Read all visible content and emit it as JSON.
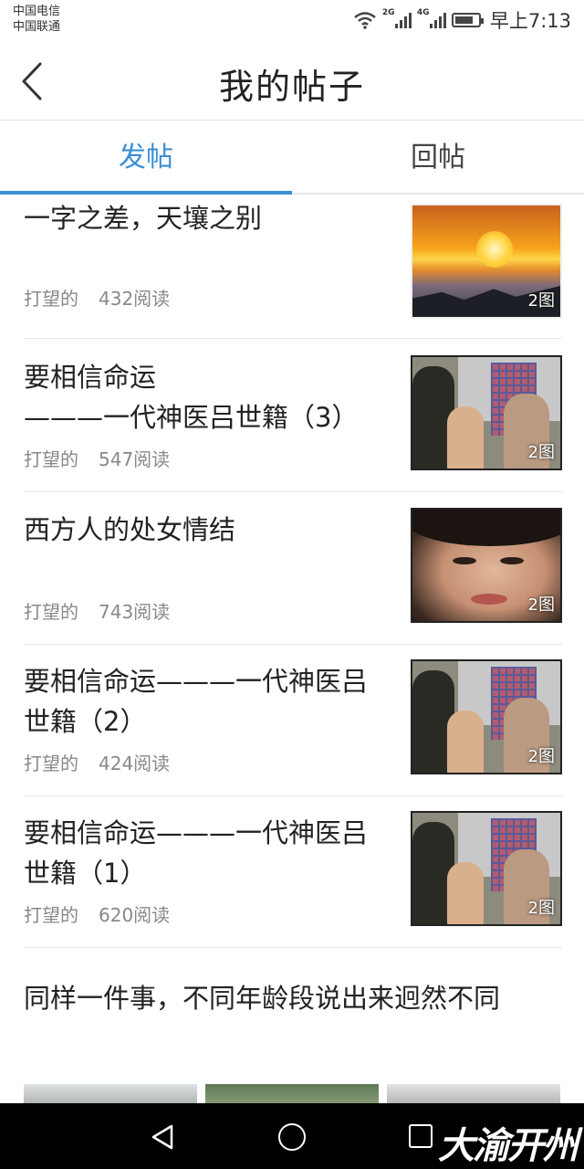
{
  "status_bar": {
    "carrier1": "中国电信",
    "carrier2": "中国联通",
    "net1": "2G",
    "net2": "4G",
    "time": "早上7:13"
  },
  "header": {
    "title": "我的帖子"
  },
  "tabs": [
    {
      "label": "发帖",
      "active": true
    },
    {
      "label": "回帖",
      "active": false
    }
  ],
  "posts": [
    {
      "title": "一字之差，天壤之别",
      "author": "打望的",
      "reads": "432阅读",
      "image_count": "2图"
    },
    {
      "title": "要相信命运\n———一代神医吕世籍（3）",
      "author": "打望的",
      "reads": "547阅读",
      "image_count": "2图"
    },
    {
      "title": "西方人的处女情结",
      "author": "打望的",
      "reads": "743阅读",
      "image_count": "2图"
    },
    {
      "title": "要相信命运———一代神医吕世籍（2）",
      "author": "打望的",
      "reads": "424阅读",
      "image_count": "2图"
    },
    {
      "title": "要相信命运———一代神医吕世籍（1）",
      "author": "打望的",
      "reads": "620阅读",
      "image_count": "2图"
    },
    {
      "title": "同样一件事，不同年龄段说出来迥然不同"
    }
  ],
  "watermark": "大渝开州",
  "colors": {
    "accent": "#3a8fd6",
    "meta_text": "#888888",
    "divider": "#e6e6e6"
  }
}
